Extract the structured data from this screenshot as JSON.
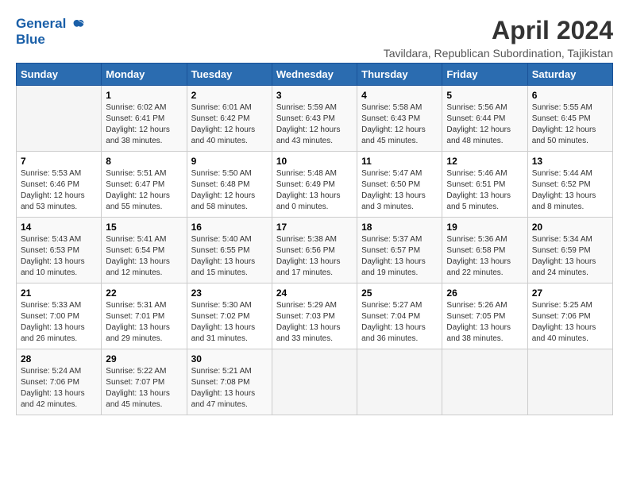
{
  "header": {
    "logo_line1": "General",
    "logo_line2": "Blue",
    "month": "April 2024",
    "location": "Tavildara, Republican Subordination, Tajikistan"
  },
  "weekdays": [
    "Sunday",
    "Monday",
    "Tuesday",
    "Wednesday",
    "Thursday",
    "Friday",
    "Saturday"
  ],
  "weeks": [
    [
      {
        "day": "",
        "info": ""
      },
      {
        "day": "1",
        "info": "Sunrise: 6:02 AM\nSunset: 6:41 PM\nDaylight: 12 hours\nand 38 minutes."
      },
      {
        "day": "2",
        "info": "Sunrise: 6:01 AM\nSunset: 6:42 PM\nDaylight: 12 hours\nand 40 minutes."
      },
      {
        "day": "3",
        "info": "Sunrise: 5:59 AM\nSunset: 6:43 PM\nDaylight: 12 hours\nand 43 minutes."
      },
      {
        "day": "4",
        "info": "Sunrise: 5:58 AM\nSunset: 6:43 PM\nDaylight: 12 hours\nand 45 minutes."
      },
      {
        "day": "5",
        "info": "Sunrise: 5:56 AM\nSunset: 6:44 PM\nDaylight: 12 hours\nand 48 minutes."
      },
      {
        "day": "6",
        "info": "Sunrise: 5:55 AM\nSunset: 6:45 PM\nDaylight: 12 hours\nand 50 minutes."
      }
    ],
    [
      {
        "day": "7",
        "info": "Sunrise: 5:53 AM\nSunset: 6:46 PM\nDaylight: 12 hours\nand 53 minutes."
      },
      {
        "day": "8",
        "info": "Sunrise: 5:51 AM\nSunset: 6:47 PM\nDaylight: 12 hours\nand 55 minutes."
      },
      {
        "day": "9",
        "info": "Sunrise: 5:50 AM\nSunset: 6:48 PM\nDaylight: 12 hours\nand 58 minutes."
      },
      {
        "day": "10",
        "info": "Sunrise: 5:48 AM\nSunset: 6:49 PM\nDaylight: 13 hours\nand 0 minutes."
      },
      {
        "day": "11",
        "info": "Sunrise: 5:47 AM\nSunset: 6:50 PM\nDaylight: 13 hours\nand 3 minutes."
      },
      {
        "day": "12",
        "info": "Sunrise: 5:46 AM\nSunset: 6:51 PM\nDaylight: 13 hours\nand 5 minutes."
      },
      {
        "day": "13",
        "info": "Sunrise: 5:44 AM\nSunset: 6:52 PM\nDaylight: 13 hours\nand 8 minutes."
      }
    ],
    [
      {
        "day": "14",
        "info": "Sunrise: 5:43 AM\nSunset: 6:53 PM\nDaylight: 13 hours\nand 10 minutes."
      },
      {
        "day": "15",
        "info": "Sunrise: 5:41 AM\nSunset: 6:54 PM\nDaylight: 13 hours\nand 12 minutes."
      },
      {
        "day": "16",
        "info": "Sunrise: 5:40 AM\nSunset: 6:55 PM\nDaylight: 13 hours\nand 15 minutes."
      },
      {
        "day": "17",
        "info": "Sunrise: 5:38 AM\nSunset: 6:56 PM\nDaylight: 13 hours\nand 17 minutes."
      },
      {
        "day": "18",
        "info": "Sunrise: 5:37 AM\nSunset: 6:57 PM\nDaylight: 13 hours\nand 19 minutes."
      },
      {
        "day": "19",
        "info": "Sunrise: 5:36 AM\nSunset: 6:58 PM\nDaylight: 13 hours\nand 22 minutes."
      },
      {
        "day": "20",
        "info": "Sunrise: 5:34 AM\nSunset: 6:59 PM\nDaylight: 13 hours\nand 24 minutes."
      }
    ],
    [
      {
        "day": "21",
        "info": "Sunrise: 5:33 AM\nSunset: 7:00 PM\nDaylight: 13 hours\nand 26 minutes."
      },
      {
        "day": "22",
        "info": "Sunrise: 5:31 AM\nSunset: 7:01 PM\nDaylight: 13 hours\nand 29 minutes."
      },
      {
        "day": "23",
        "info": "Sunrise: 5:30 AM\nSunset: 7:02 PM\nDaylight: 13 hours\nand 31 minutes."
      },
      {
        "day": "24",
        "info": "Sunrise: 5:29 AM\nSunset: 7:03 PM\nDaylight: 13 hours\nand 33 minutes."
      },
      {
        "day": "25",
        "info": "Sunrise: 5:27 AM\nSunset: 7:04 PM\nDaylight: 13 hours\nand 36 minutes."
      },
      {
        "day": "26",
        "info": "Sunrise: 5:26 AM\nSunset: 7:05 PM\nDaylight: 13 hours\nand 38 minutes."
      },
      {
        "day": "27",
        "info": "Sunrise: 5:25 AM\nSunset: 7:06 PM\nDaylight: 13 hours\nand 40 minutes."
      }
    ],
    [
      {
        "day": "28",
        "info": "Sunrise: 5:24 AM\nSunset: 7:06 PM\nDaylight: 13 hours\nand 42 minutes."
      },
      {
        "day": "29",
        "info": "Sunrise: 5:22 AM\nSunset: 7:07 PM\nDaylight: 13 hours\nand 45 minutes."
      },
      {
        "day": "30",
        "info": "Sunrise: 5:21 AM\nSunset: 7:08 PM\nDaylight: 13 hours\nand 47 minutes."
      },
      {
        "day": "",
        "info": ""
      },
      {
        "day": "",
        "info": ""
      },
      {
        "day": "",
        "info": ""
      },
      {
        "day": "",
        "info": ""
      }
    ]
  ]
}
